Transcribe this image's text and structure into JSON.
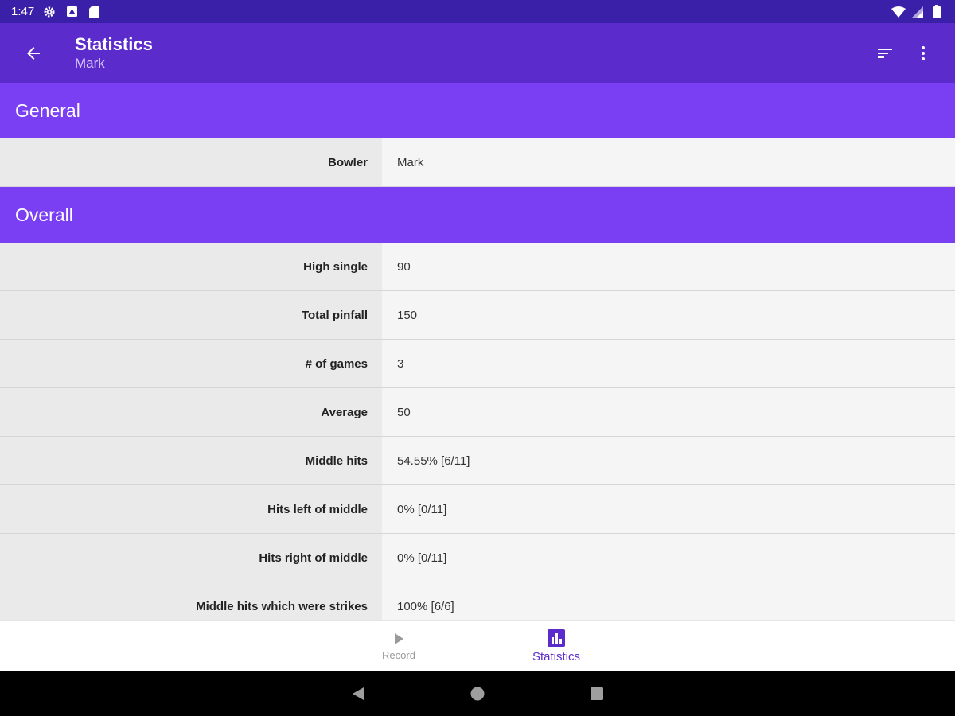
{
  "status_bar": {
    "time": "1:47",
    "icons": [
      "settings-icon",
      "notification-icon",
      "sd-card-icon",
      "wifi-icon",
      "signal-icon",
      "battery-icon"
    ]
  },
  "app_bar": {
    "title": "Statistics",
    "subtitle": "Mark",
    "icons": [
      "back-arrow-icon",
      "sort-icon",
      "more-vert-icon"
    ]
  },
  "sections": {
    "general": {
      "header": "General",
      "rows": [
        {
          "label": "Bowler",
          "value": "Mark"
        }
      ]
    },
    "overall": {
      "header": "Overall",
      "rows": [
        {
          "label": "High single",
          "value": "90"
        },
        {
          "label": "Total pinfall",
          "value": "150"
        },
        {
          "label": "# of games",
          "value": "3"
        },
        {
          "label": "Average",
          "value": "50"
        },
        {
          "label": "Middle hits",
          "value": "54.55% [6/11]"
        },
        {
          "label": "Hits left of middle",
          "value": "0% [0/11]"
        },
        {
          "label": "Hits right of middle",
          "value": "0% [0/11]"
        },
        {
          "label": "Middle hits which were strikes",
          "value": "100% [6/6]"
        }
      ]
    }
  },
  "bottom_nav": {
    "items": [
      {
        "label": "Record",
        "icon": "play-icon",
        "active": false
      },
      {
        "label": "Statistics",
        "icon": "bar-chart-icon",
        "active": true
      }
    ]
  },
  "system_nav": {
    "icons": [
      "back-triangle-icon",
      "home-circle-icon",
      "recents-square-icon"
    ]
  },
  "colors": {
    "status_bar": "#3a1fa8",
    "app_bar": "#5b2ccb",
    "section_header": "#7a3ff3",
    "accent": "#5b2ccb"
  }
}
